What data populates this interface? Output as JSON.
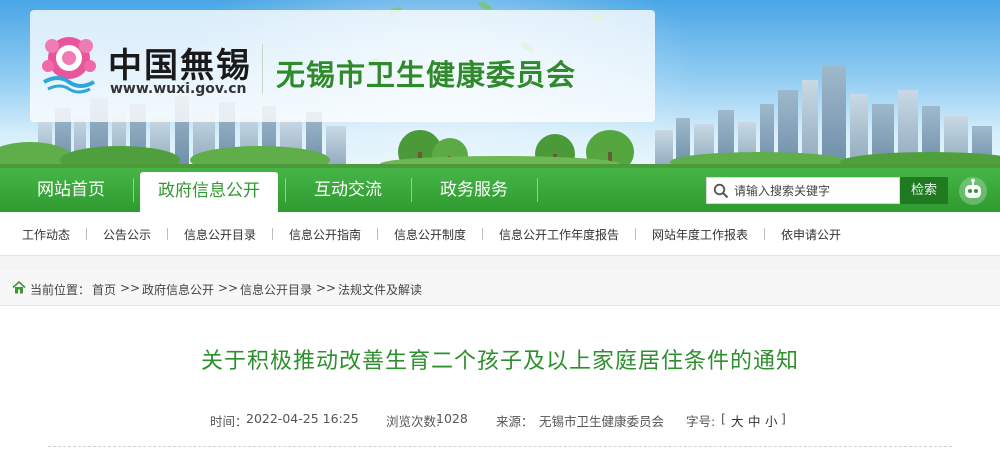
{
  "header": {
    "logo_title": "中国無锡",
    "logo_url": "www.wuxi.gov.cn",
    "org_name": "无锡市卫生健康委员会"
  },
  "mainnav": {
    "items": [
      {
        "label": "网站首页",
        "active": false
      },
      {
        "label": "政府信息公开",
        "active": true
      },
      {
        "label": "互动交流",
        "active": false
      },
      {
        "label": "政务服务",
        "active": false
      }
    ],
    "search": {
      "placeholder": "请输入搜索关键字",
      "button_label": "检索"
    }
  },
  "subnav": {
    "items": [
      "工作动态",
      "公告公示",
      "信息公开目录",
      "信息公开指南",
      "信息公开制度",
      "信息公开工作年度报告",
      "网站年度工作报表",
      "依申请公开"
    ]
  },
  "breadcrumb": {
    "prefix": "当前位置：",
    "items": [
      "首页",
      "政府信息公开",
      "信息公开目录",
      "法规文件及解读"
    ],
    "separator": ">>"
  },
  "article": {
    "title": "关于积极推动改善生育二个孩子及以上家庭居住条件的通知",
    "time_label": "时间：",
    "time_value": "2022-04-25 16:25",
    "views_label": "浏览次数:",
    "views_value": "1028",
    "source_label": "来源：",
    "source_value": "无锡市卫生健康委员会",
    "fontsize_label": "字号:",
    "fontsize_open": "[",
    "fontsize_large": "大",
    "fontsize_medium": "中",
    "fontsize_small": "小",
    "fontsize_close": "]"
  },
  "colors": {
    "brand_green": "#2f9a30",
    "title_green": "#2d8f2d",
    "search_button": "#1f7a22"
  },
  "icons": [
    "emblem-logo",
    "search-icon",
    "robot-assistant-icon",
    "home-icon"
  ]
}
